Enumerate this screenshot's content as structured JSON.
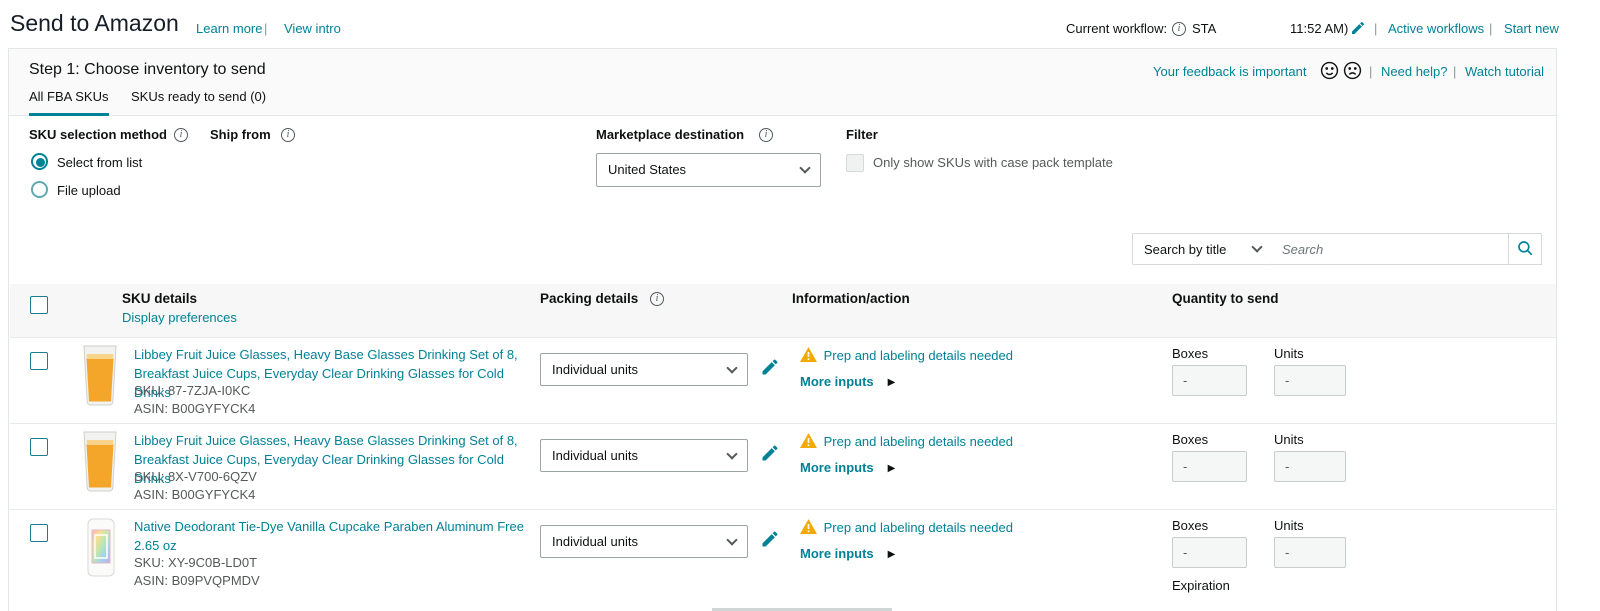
{
  "header": {
    "title": "Send to Amazon",
    "learn_more": "Learn more",
    "view_intro": "View intro",
    "divider": "|",
    "current_workflow_label": "Current workflow:",
    "current_workflow_value": "STA",
    "workflow_time": "11:52 AM)",
    "active_workflows": "Active workflows",
    "start_new": "Start new"
  },
  "step": {
    "title": "Step 1: Choose inventory to send",
    "tabs": [
      {
        "label": "All FBA SKUs"
      },
      {
        "label": "SKUs ready to send (0)"
      }
    ],
    "feedback_text": "Your feedback is important",
    "need_help": "Need help?",
    "watch_tutorial": "Watch tutorial"
  },
  "controls": {
    "sku_selection_label": "SKU selection method",
    "ship_from_label": "Ship from",
    "radio_select_from_list": "Select from list",
    "radio_file_upload": "File upload",
    "marketplace_label": "Marketplace destination",
    "marketplace_value": "United States",
    "filter_label": "Filter",
    "filter_checkbox_label": "Only show SKUs with case pack template"
  },
  "search": {
    "category_value": "Search by title",
    "placeholder": "Search"
  },
  "table": {
    "headers": {
      "sku_details": "SKU details",
      "display_preferences": "Display preferences",
      "packing_details": "Packing details",
      "information_action": "Information/action",
      "quantity_to_send": "Quantity to send"
    },
    "labels": {
      "boxes": "Boxes",
      "units": "Units",
      "expiration": "Expiration"
    },
    "rows": [
      {
        "title": "Libbey Fruit Juice Glasses, Heavy Base Glasses Drinking Set of 8, Breakfast Juice Cups, Everyday Clear Drinking Glasses for Cold Drinks",
        "sku": "SKU: 87-7ZJA-I0KC",
        "asin": "ASIN: B00GYFYCK4",
        "packing_value": "Individual units",
        "warning_text": "Prep and labeling details needed",
        "more_inputs": "More inputs",
        "boxes_value": "-",
        "units_value": "-"
      },
      {
        "title": "Libbey Fruit Juice Glasses, Heavy Base Glasses Drinking Set of 8, Breakfast Juice Cups, Everyday Clear Drinking Glasses for Cold Drinks",
        "sku": "SKU: 8X-V700-6QZV",
        "asin": "ASIN: B00GYFYCK4",
        "packing_value": "Individual units",
        "warning_text": "Prep and labeling details needed",
        "more_inputs": "More inputs",
        "boxes_value": "-",
        "units_value": "-"
      },
      {
        "title": "Native Deodorant Tie-Dye Vanilla Cupcake Paraben Aluminum Free 2.65 oz",
        "sku": "SKU: XY-9C0B-LD0T",
        "asin": "ASIN: B09PVQPMDV",
        "packing_value": "Individual units",
        "warning_text": "Prep and labeling details needed",
        "more_inputs": "More inputs",
        "boxes_value": "-",
        "units_value": "-",
        "expiration_label": "Expiration"
      }
    ]
  },
  "icons": {
    "info_glyph": "i",
    "arrow_right_triangle": "▶",
    "names": [
      "info-icon",
      "edit-pencil-icon",
      "warning-triangle-icon",
      "search-magnifier-icon",
      "chevron-down-icon",
      "smiley-face-icon",
      "frown-face-icon",
      "checkbox",
      "radio-button"
    ]
  },
  "colors": {
    "link_teal": "#008296",
    "text_dark": "#0F1111",
    "text_muted": "#565959",
    "warning_amber": "#F2A900",
    "border_gray": "#D5D9D9",
    "card_header_bg": "#FAFAFA",
    "table_header_bg": "#F7F7F7"
  }
}
